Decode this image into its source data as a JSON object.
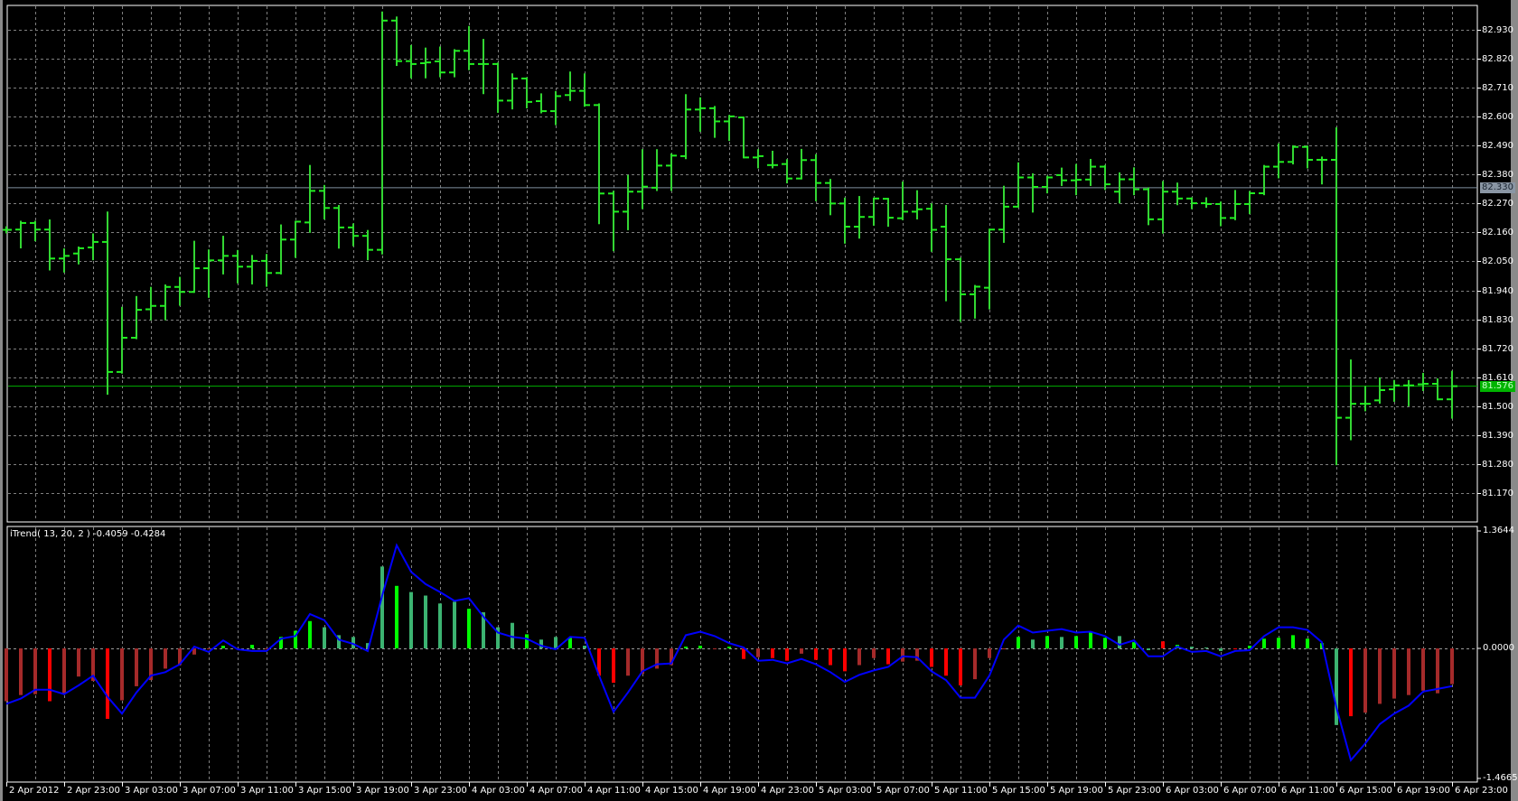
{
  "chart_data": [
    {
      "type": "ohlc-bar",
      "symbol_note": "",
      "time_labels": [
        "2 Apr 2012",
        "2 Apr 23:00",
        "3 Apr 03:00",
        "3 Apr 07:00",
        "3 Apr 11:00",
        "3 Apr 15:00",
        "3 Apr 19:00",
        "3 Apr 23:00",
        "4 Apr 03:00",
        "4 Apr 07:00",
        "4 Apr 11:00",
        "4 Apr 15:00",
        "4 Apr 19:00",
        "4 Apr 23:00",
        "5 Apr 03:00",
        "5 Apr 07:00",
        "5 Apr 11:00",
        "5 Apr 15:00",
        "5 Apr 19:00",
        "5 Apr 23:00",
        "6 Apr 03:00",
        "6 Apr 07:00",
        "6 Apr 11:00",
        "6 Apr 15:00",
        "6 Apr 19:00",
        "6 Apr 23:00"
      ],
      "price_ticks": [
        "82.930",
        "82.820",
        "82.710",
        "82.600",
        "82.490",
        "82.380",
        "82.270",
        "82.160",
        "82.050",
        "81.940",
        "81.830",
        "81.720",
        "81.610",
        "81.500",
        "81.390",
        "81.280",
        "81.170"
      ],
      "ylim": [
        81.06,
        83.012
      ],
      "current_price": "81.576",
      "level_line": "82.330",
      "ohlc": [
        [
          82.17,
          82.18,
          82.16,
          82.17
        ],
        [
          82.171,
          82.201,
          82.103,
          82.196
        ],
        [
          82.196,
          82.201,
          82.13,
          82.171
        ],
        [
          82.171,
          82.206,
          82.019,
          82.061
        ],
        [
          82.061,
          82.096,
          82.011,
          82.071
        ],
        [
          82.08,
          82.103,
          82.042,
          82.1
        ],
        [
          82.103,
          82.153,
          82.058,
          82.124
        ],
        [
          82.124,
          82.236,
          81.547,
          81.63
        ],
        [
          81.63,
          81.874,
          81.627,
          81.76
        ],
        [
          81.76,
          81.915,
          81.758,
          81.866
        ],
        [
          81.868,
          81.95,
          81.83,
          81.881
        ],
        [
          81.881,
          81.959,
          81.83,
          81.953
        ],
        [
          81.953,
          81.988,
          81.885,
          81.934
        ],
        [
          81.934,
          82.125,
          81.934,
          82.024
        ],
        [
          82.024,
          82.092,
          81.915,
          82.054
        ],
        [
          82.054,
          82.144,
          82.004,
          82.071
        ],
        [
          82.071,
          82.09,
          81.97,
          82.03
        ],
        [
          82.03,
          82.071,
          81.966,
          82.052
        ],
        [
          82.052,
          82.075,
          81.957,
          82.006
        ],
        [
          82.006,
          82.187,
          82.004,
          82.133
        ],
        [
          82.133,
          82.201,
          82.067,
          82.201
        ],
        [
          82.198,
          82.413,
          82.162,
          82.318
        ],
        [
          82.318,
          82.337,
          82.213,
          82.253
        ],
        [
          82.253,
          82.261,
          82.102,
          82.179
        ],
        [
          82.179,
          82.191,
          82.111,
          82.147
        ],
        [
          82.147,
          82.166,
          82.058,
          82.094
        ],
        [
          82.094,
          82.996,
          82.08,
          82.965
        ],
        [
          82.965,
          82.977,
          82.796,
          82.811
        ],
        [
          82.811,
          82.869,
          82.749,
          82.8
        ],
        [
          82.803,
          82.859,
          82.749,
          82.806
        ],
        [
          82.81,
          82.863,
          82.753,
          82.768
        ],
        [
          82.768,
          82.853,
          82.753,
          82.85
        ],
        [
          82.85,
          82.941,
          82.78,
          82.8
        ],
        [
          82.8,
          82.892,
          82.689,
          82.8
        ],
        [
          82.8,
          82.802,
          82.618,
          82.661
        ],
        [
          82.661,
          82.761,
          82.631,
          82.745
        ],
        [
          82.745,
          82.746,
          82.635,
          82.656
        ],
        [
          82.659,
          82.685,
          82.616,
          82.621
        ],
        [
          82.621,
          82.694,
          82.571,
          82.678
        ],
        [
          82.682,
          82.768,
          82.663,
          82.698
        ],
        [
          82.698,
          82.761,
          82.641,
          82.644
        ],
        [
          82.644,
          82.647,
          82.195,
          82.308
        ],
        [
          82.308,
          82.315,
          82.092,
          82.239
        ],
        [
          82.239,
          82.375,
          82.172,
          82.315
        ],
        [
          82.315,
          82.473,
          82.252,
          82.334
        ],
        [
          82.33,
          82.473,
          82.321,
          82.414
        ],
        [
          82.414,
          82.457,
          82.321,
          82.452
        ],
        [
          82.45,
          82.682,
          82.442,
          82.627
        ],
        [
          82.627,
          82.67,
          82.546,
          82.632
        ],
        [
          82.632,
          82.637,
          82.523,
          82.582
        ],
        [
          82.582,
          82.603,
          82.511,
          82.601
        ],
        [
          82.597,
          82.597,
          82.445,
          82.445
        ],
        [
          82.445,
          82.473,
          82.407,
          82.45
        ],
        [
          82.416,
          82.467,
          82.407,
          82.416
        ],
        [
          82.42,
          82.435,
          82.35,
          82.365
        ],
        [
          82.365,
          82.474,
          82.365,
          82.435
        ],
        [
          82.435,
          82.454,
          82.282,
          82.348
        ],
        [
          82.348,
          82.36,
          82.229,
          82.27
        ],
        [
          82.27,
          82.289,
          82.121,
          82.182
        ],
        [
          82.182,
          82.295,
          82.14,
          82.219
        ],
        [
          82.219,
          82.289,
          82.189,
          82.289
        ],
        [
          82.288,
          82.288,
          82.185,
          82.216
        ],
        [
          82.214,
          82.35,
          82.21,
          82.239
        ],
        [
          82.239,
          82.317,
          82.213,
          82.248
        ],
        [
          82.25,
          82.267,
          82.09,
          82.17
        ],
        [
          82.182,
          82.261,
          81.902,
          82.058
        ],
        [
          82.058,
          82.061,
          81.824,
          81.925
        ],
        [
          81.925,
          81.957,
          81.836,
          81.954
        ],
        [
          81.95,
          82.171,
          81.871,
          82.171
        ],
        [
          82.171,
          82.334,
          82.124,
          82.258
        ],
        [
          82.258,
          82.423,
          82.258,
          82.369
        ],
        [
          82.369,
          82.381,
          82.239,
          82.333
        ],
        [
          82.333,
          82.372,
          82.312,
          82.369
        ],
        [
          82.378,
          82.403,
          82.34,
          82.358
        ],
        [
          82.358,
          82.417,
          82.305,
          82.36
        ],
        [
          82.361,
          82.436,
          82.34,
          82.41
        ],
        [
          82.41,
          82.413,
          82.325,
          82.343
        ],
        [
          82.315,
          82.385,
          82.274,
          82.362
        ],
        [
          82.362,
          82.404,
          82.305,
          82.324
        ],
        [
          82.324,
          82.328,
          82.191,
          82.21
        ],
        [
          82.21,
          82.352,
          82.159,
          82.315
        ],
        [
          82.315,
          82.346,
          82.267,
          82.289
        ],
        [
          82.289,
          82.29,
          82.252,
          82.271
        ],
        [
          82.271,
          82.29,
          82.257,
          82.268
        ],
        [
          82.268,
          82.274,
          82.187,
          82.215
        ],
        [
          82.215,
          82.318,
          82.21,
          82.268
        ],
        [
          82.268,
          82.314,
          82.233,
          82.309
        ],
        [
          82.309,
          82.413,
          82.305,
          82.41
        ],
        [
          82.41,
          82.495,
          82.369,
          82.428
        ],
        [
          82.428,
          82.488,
          82.422,
          82.485
        ],
        [
          82.485,
          82.487,
          82.407,
          82.436
        ],
        [
          82.436,
          82.445,
          82.346,
          82.436
        ],
        [
          82.436,
          82.556,
          81.279,
          81.456
        ],
        [
          81.456,
          81.674,
          81.374,
          81.509
        ],
        [
          81.509,
          81.573,
          81.484,
          81.509
        ],
        [
          81.522,
          81.606,
          81.513,
          81.561
        ],
        [
          81.564,
          81.596,
          81.52,
          81.579
        ],
        [
          81.579,
          81.596,
          81.503,
          81.579
        ],
        [
          81.583,
          81.623,
          81.561,
          81.585
        ],
        [
          81.585,
          81.602,
          81.526,
          81.526
        ],
        [
          81.526,
          81.631,
          81.456,
          81.576
        ]
      ]
    },
    {
      "type": "histogram+line",
      "title": "iTrend( 13, 20, 2 ) -0.4059 -0.4284",
      "axis_labels": {
        "top": "1.3644",
        "zero": "0.0000",
        "bottom": "-1.4665"
      },
      "ylim": [
        -1.4665,
        1.3644
      ],
      "colors": {
        "r": "#ff0000",
        "b": "#a52a2a",
        "g": "#00ff00",
        "s": "#3cb371",
        "line": "#0000ff"
      },
      "histogram": [
        -0.6,
        -0.53,
        -0.52,
        -0.6,
        -0.51,
        -0.32,
        -0.37,
        -0.8,
        -0.59,
        -0.43,
        -0.36,
        -0.23,
        -0.19,
        -0.07,
        0,
        0.03,
        0,
        0.04,
        -0.01,
        0.13,
        0.2,
        0.31,
        0.24,
        0.15,
        0.13,
        0.06,
        0.93,
        0.71,
        0.64,
        0.6,
        0.51,
        0.53,
        0.45,
        0.41,
        0.24,
        0.29,
        0.16,
        0.1,
        0.13,
        0.12,
        0.03,
        -0.31,
        -0.39,
        -0.31,
        -0.29,
        -0.23,
        -0.19,
        0.02,
        0.03,
        -0.01,
        0.02,
        -0.12,
        -0.1,
        -0.11,
        -0.14,
        -0.06,
        -0.13,
        -0.19,
        -0.26,
        -0.19,
        -0.11,
        -0.18,
        -0.15,
        -0.14,
        -0.21,
        -0.31,
        -0.42,
        -0.35,
        -0.11,
        0,
        0.13,
        0.1,
        0.14,
        0.13,
        0.14,
        0.18,
        0.12,
        0.14,
        0.07,
        -0.02,
        0.08,
        0.04,
        0.02,
        0.01,
        -0.03,
        0,
        0.03,
        0.11,
        0.12,
        0.15,
        0.11,
        0.06,
        -0.87,
        -0.77,
        -0.73,
        -0.63,
        -0.57,
        -0.53,
        -0.48,
        -0.51,
        -0.4059
      ],
      "histogram_colors": "bbbrbbbrbbbbbbbgbgbgggsssssgssssgsssgssgsrrbbbbggbgrbrrbrrrbbrbbrrrbbbgsgsgggsgsrgsssrggggggsrbbbbbbbrb",
      "line": [
        -0.63,
        -0.57,
        -0.47,
        -0.47,
        -0.52,
        -0.42,
        -0.31,
        -0.55,
        -0.74,
        -0.5,
        -0.31,
        -0.27,
        -0.18,
        0.02,
        -0.04,
        0.09,
        -0.01,
        -0.03,
        -0.03,
        0.11,
        0.14,
        0.39,
        0.32,
        0.1,
        0.05,
        -0.03,
        0.6,
        1.17,
        0.87,
        0.73,
        0.64,
        0.54,
        0.57,
        0.36,
        0.18,
        0.13,
        0.11,
        0.03,
        -0.01,
        0.13,
        0.12,
        -0.31,
        -0.72,
        -0.5,
        -0.26,
        -0.18,
        -0.17,
        0.15,
        0.19,
        0.14,
        0.06,
        0.01,
        -0.14,
        -0.13,
        -0.17,
        -0.12,
        -0.18,
        -0.27,
        -0.38,
        -0.3,
        -0.25,
        -0.21,
        -0.09,
        -0.1,
        -0.26,
        -0.36,
        -0.56,
        -0.56,
        -0.31,
        0.1,
        0.26,
        0.18,
        0.2,
        0.22,
        0.18,
        0.19,
        0.14,
        0.04,
        0.09,
        -0.09,
        -0.09,
        0.02,
        -0.04,
        -0.03,
        -0.09,
        -0.03,
        -0.02,
        0.14,
        0.24,
        0.24,
        0.21,
        0.07,
        -0.67,
        -1.27,
        -1.08,
        -0.86,
        -0.74,
        -0.65,
        -0.49,
        -0.46,
        -0.4284
      ]
    }
  ]
}
